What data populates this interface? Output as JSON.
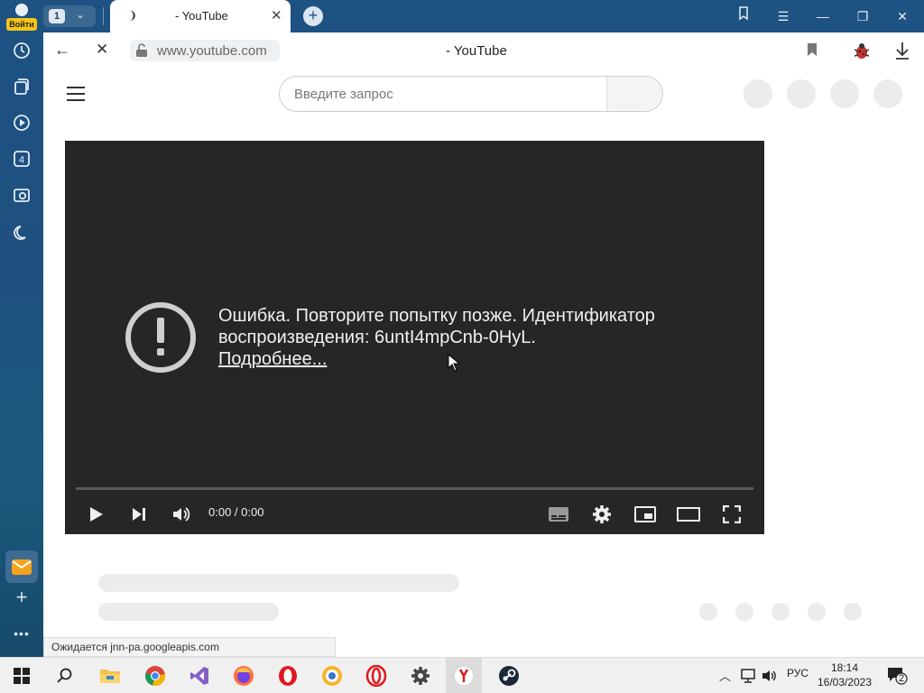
{
  "sidebar": {
    "login_label": "Войти",
    "icons": [
      "history-icon",
      "collections-icon",
      "video-icon",
      "badge-4-icon",
      "screenshot-icon",
      "moon-icon"
    ],
    "badge_number": "4"
  },
  "tabs": {
    "count": "1",
    "active_title": "- YouTube",
    "spinner": "❩"
  },
  "address": {
    "url": "www.youtube.com",
    "page_title": "- YouTube"
  },
  "youtube": {
    "search_placeholder": "Введите запрос"
  },
  "player": {
    "error_message": "Ошибка. Повторите попытку позже. Идентификатор воспроизведения: 6untI4mpCnb-0HyL.",
    "error_link": "Подробнее...",
    "time": "0:00 / 0:00"
  },
  "status": {
    "text": "Ожидается jnn-pa.googleapis.com"
  },
  "taskbar": {
    "lang": "РУС",
    "time": "18:14",
    "date": "16/03/2023",
    "notifications": "2"
  }
}
